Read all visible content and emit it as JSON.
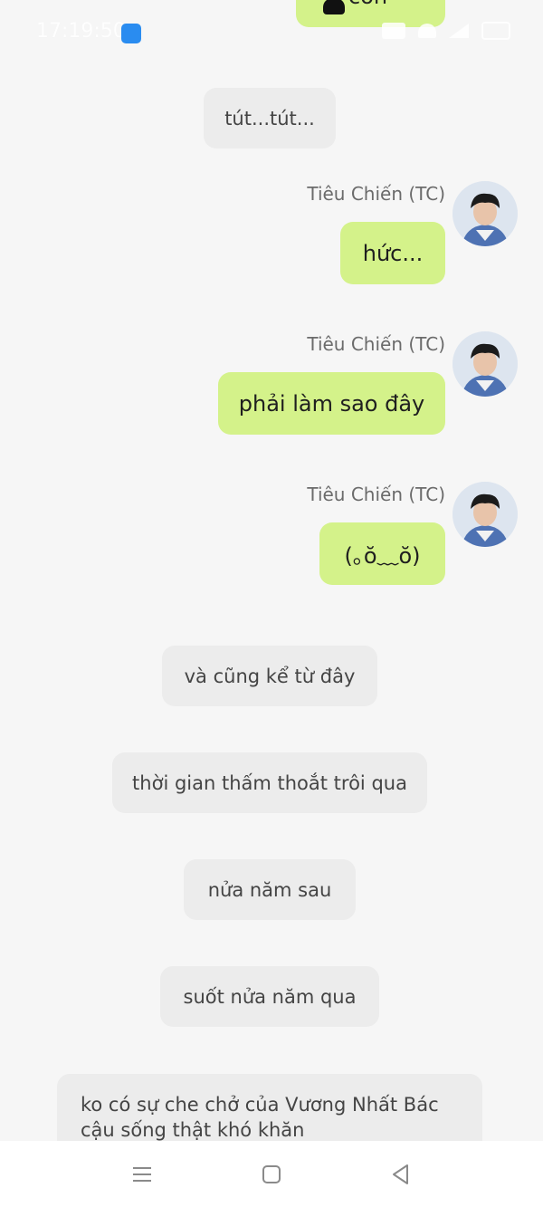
{
  "status_bar": {
    "time": "17:19:50",
    "app_icon": "wifi-share-icon",
    "icons": [
      "data-icon",
      "wifi-icon",
      "signal-icon",
      "battery-icon"
    ]
  },
  "top_partial_bubble": {
    "label": "con",
    "icon": "phone-icon"
  },
  "colors": {
    "background": "#f6f6f6",
    "bubble_green": "#d4f28a",
    "system_bubble": "#ececec",
    "name_gray": "#6b6b6b"
  },
  "messages": [
    {
      "type": "system",
      "text": "tút...tút..."
    },
    {
      "type": "user",
      "sender": "Tiêu Chiến (TC)",
      "text": "hức..."
    },
    {
      "type": "user",
      "sender": "Tiêu Chiến (TC)",
      "text": "phải làm sao đây"
    },
    {
      "type": "user",
      "sender": "Tiêu Chiến (TC)",
      "text": "(｡ŏ﹏ŏ)"
    },
    {
      "type": "system",
      "text": "và cũng kể từ đây"
    },
    {
      "type": "system",
      "text": "thời gian thấm thoắt trôi qua"
    },
    {
      "type": "system",
      "text": "nửa năm sau"
    },
    {
      "type": "system",
      "text": "suốt nửa năm qua"
    },
    {
      "type": "system",
      "text": "ko có sự che chở của Vương Nhất Bác cậu sống thật khó khăn"
    }
  ],
  "nav_bar": {
    "buttons": [
      "menu-icon",
      "home-icon",
      "back-icon"
    ]
  }
}
